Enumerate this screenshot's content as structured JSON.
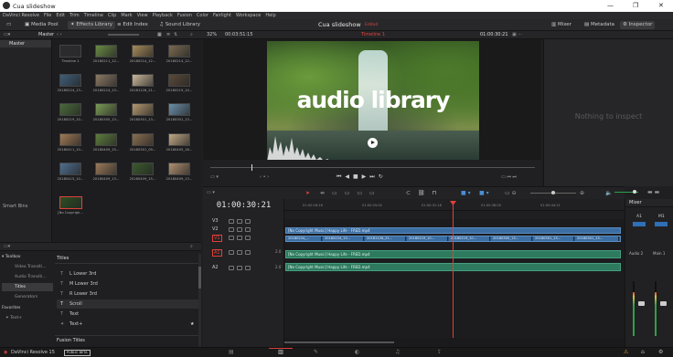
{
  "window": {
    "title": "Cua slideshow",
    "controls": [
      "—",
      "❐",
      "✕"
    ]
  },
  "menu": [
    "DaVinci Resolve",
    "File",
    "Edit",
    "Trim",
    "Timeline",
    "Clip",
    "Mark",
    "View",
    "Playback",
    "Fusion",
    "Color",
    "Fairlight",
    "Workspace",
    "Help"
  ],
  "toolbar": {
    "media_pool": "Media Pool",
    "effects_library": "Effects Library",
    "edit_index": "Edit Index",
    "sound_library": "Sound Library",
    "project_title": "Cua slideshow",
    "project_status": "Edited",
    "mixer": "Mixer",
    "metadata": "Metadata",
    "inspector": "Inspector"
  },
  "media_pool": {
    "master_label": "Master",
    "bin_master": "Master",
    "smart_bins": "Smart Bins",
    "clips": [
      "Timeline 1",
      "20180211_12...",
      "20180214_12...",
      "20180214_12...",
      "20180224_13...",
      "20180224_13...",
      "20181126_21...",
      "20180219_10...",
      "20180219_10...",
      "20180305_13...",
      "20180301_13...",
      "20180301_13...",
      "20180411_10...",
      "20180409_15...",
      "20180301_09...",
      "20180405_16...",
      "20180415_10...",
      "20180409_13...",
      "20180409_15...",
      "20180409_13...",
      "[No Copyrigh..."
    ]
  },
  "viewer": {
    "zoom": "32%",
    "timecode_left": "00:03:51:15",
    "timeline_name": "Timeline 1",
    "timecode_right": "01:00:30:21",
    "overlay_text": "audio library"
  },
  "inspector": {
    "empty_text": "Nothing to inspect"
  },
  "effects": {
    "toolbox": "Toolbox",
    "categories": [
      "Video Transiti...",
      "Audio Transiti...",
      "Titles",
      "Generators"
    ],
    "favorites": "Favorites",
    "favorite_item": "Text+",
    "header": "Titles",
    "items": [
      "L Lower 3rd",
      "M Lower 3rd",
      "R Lower 3rd",
      "Scroll",
      "Text",
      "Text+"
    ],
    "footer": "Fusion Titles"
  },
  "timeline": {
    "timecode": "01:00:30:21",
    "ruler": [
      "01:00:18:16",
      "01:00:25:02",
      "01:00:31:18",
      "01:00:38:05",
      "01:00:44:21"
    ],
    "tracks": [
      {
        "name": "V3"
      },
      {
        "name": "V2"
      },
      {
        "name": "V1"
      },
      {
        "name": "A1",
        "channels": "2.0"
      },
      {
        "name": "A2",
        "channels": "2.0"
      }
    ],
    "v2_clip": "[No Copyright Music] Happy Life - FRED.mp4",
    "v1_clips": [
      "20180224_...",
      "20180224_13...",
      "20181126_21...",
      "20180219_10...",
      "20180219_10...",
      "20180305_13...",
      "20180301_13...",
      "20180301_13..."
    ],
    "a1_clip": "[No Copyright Music] Happy Life - FRED.mp4",
    "a2_clip": "[No Copyright Music] Happy Life - FRED.mp4"
  },
  "mixer": {
    "title": "Mixer",
    "ch1": "A1",
    "ch2": "M1",
    "a2": "Audio 2",
    "main": "Main 1"
  },
  "status": {
    "app": "DaVinci Resolve 15",
    "badge": "PUBLIC BETA"
  },
  "colors": {
    "accent_red": "#e0413a",
    "clip_blue": "#3b6ea3",
    "clip_green": "#2d7a5e",
    "playhead": "#e0413a"
  }
}
